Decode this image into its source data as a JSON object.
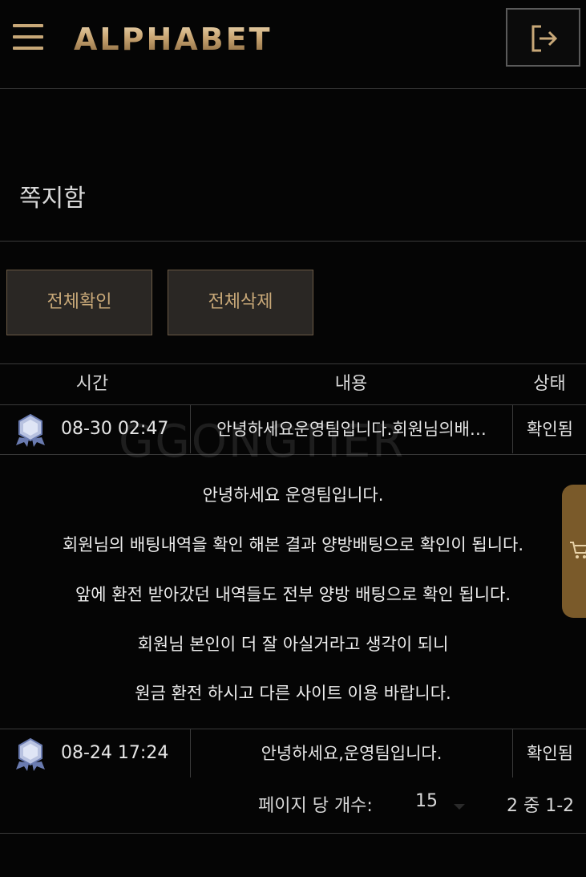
{
  "header": {
    "logo_text": "ALPHABET",
    "menu_icon": "hamburger-menu-icon",
    "logout_icon": "logout-icon"
  },
  "page": {
    "title": "쪽지함"
  },
  "actions": {
    "read_all_label": "전체확인",
    "delete_all_label": "전체삭제"
  },
  "table": {
    "columns": [
      "시간",
      "내용",
      "상태"
    ],
    "rows": [
      {
        "time": "08-30 02:47",
        "content": "안녕하세요운영팀입니다.회원님의배…",
        "status": "확인됨",
        "icon": "medal-icon",
        "expanded": true,
        "body_lines": [
          "안녕하세요 운영팀입니다.",
          "회원님의 배팅내역을 확인 해본 결과 양방배팅으로 확인이 됩니다.",
          "앞에 환전 받아갔던 내역들도 전부 양방 배팅으로 확인 됩니다.",
          "회원님 본인이 더 잘 아실거라고 생각이 되니",
          "원금 환전 하시고 다른 사이트 이용 바랍니다."
        ]
      },
      {
        "time": "08-24 17:24",
        "content": "안녕하세요,운영팀입니다.",
        "status": "확인됨",
        "icon": "medal-icon",
        "expanded": false
      }
    ]
  },
  "pagination": {
    "per_page_label": "페이지 당 개수:",
    "per_page_value": "15",
    "page_info": "2 중 1-2"
  },
  "watermark": "GGONGTIER",
  "side_tab": {
    "icon": "cart-icon"
  },
  "colors": {
    "background": "#050505",
    "accent_gold": "#c8a878",
    "button_bg": "#2a2724",
    "divider": "#3a3a3a",
    "side_tab": "#7a5a2a"
  }
}
